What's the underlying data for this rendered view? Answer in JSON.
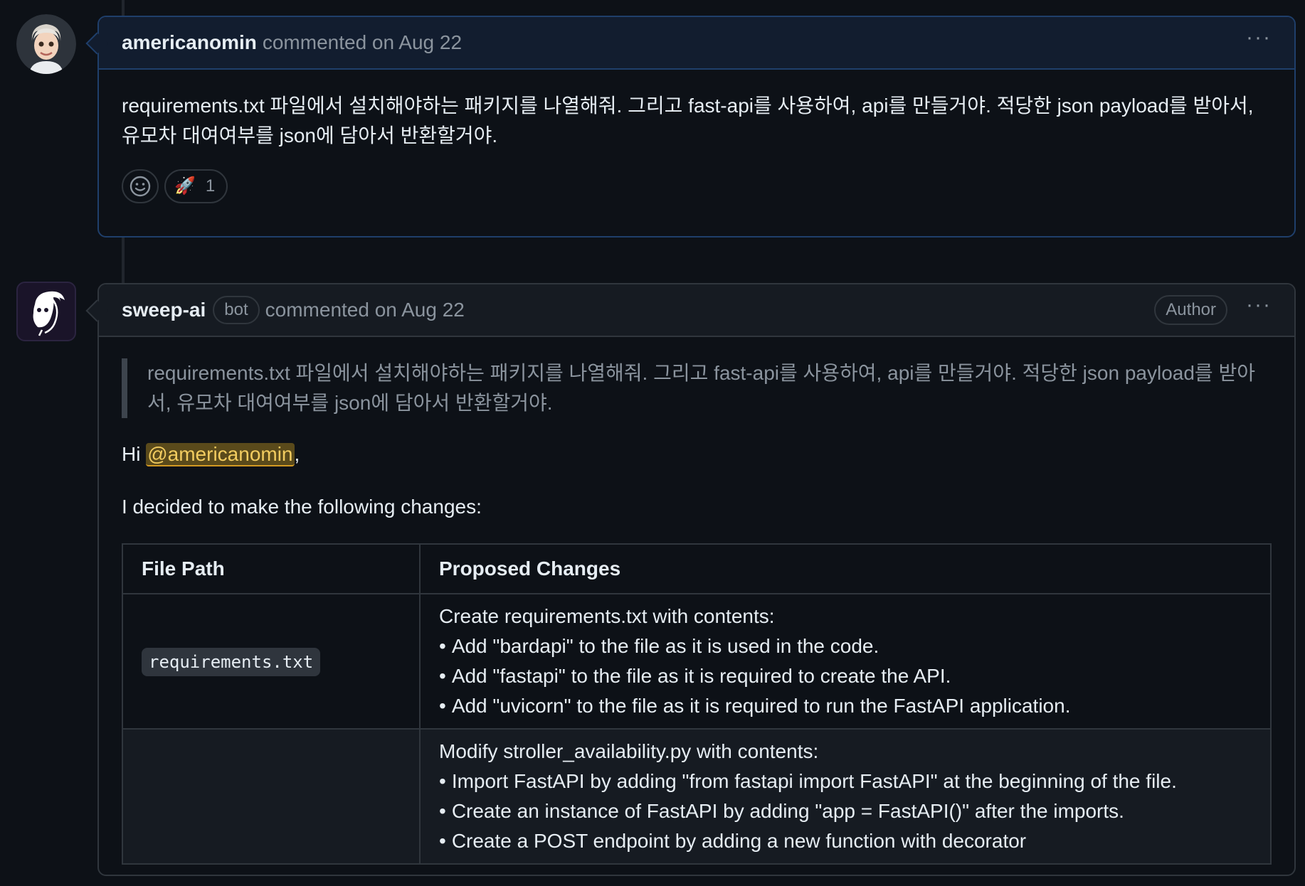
{
  "comments": [
    {
      "author": "americanomin",
      "meta": "commented on Aug 22",
      "body": "requirements.txt 파일에서 설치해야하는 패키지를 나열해줘. 그리고 fast-api를 사용하여, api를 만들거야. 적당한 json payload를 받아서, 유모차 대여여부를 json에 담아서 반환할거야.",
      "reactions": [
        {
          "icon": "rocket-icon",
          "emoji": "🚀",
          "count": "1"
        }
      ]
    },
    {
      "author": "sweep-ai",
      "bot_label": "bot",
      "meta": "commented on Aug 22",
      "author_badge": "Author",
      "quote": "requirements.txt 파일에서 설치해야하는 패키지를 나열해줘. 그리고 fast-api를 사용하여, api를 만들거야. 적당한 json payload를 받아서, 유모차 대여여부를 json에 담아서 반환할거야.",
      "greeting_prefix": "Hi ",
      "mention": "@americanomin",
      "greeting_suffix": ",",
      "intro": "I decided to make the following changes:",
      "table": {
        "headers": [
          "File Path",
          "Proposed Changes"
        ],
        "rows": [
          {
            "path": "requirements.txt",
            "title": "Create requirements.txt with contents:",
            "bullets": [
              "Add \"bardapi\" to the file as it is used in the code.",
              "Add \"fastapi\" to the file as it is required to create the API.",
              "Add \"uvicorn\" to the file as it is required to run the FastAPI application."
            ]
          },
          {
            "path": "",
            "title": "Modify stroller_availability.py with contents:",
            "bullets": [
              "Import FastAPI by adding \"from fastapi import FastAPI\" at the beginning of the file.",
              "Create an instance of FastAPI by adding \"app = FastAPI()\" after the imports.",
              "Create a POST endpoint by adding a new function with decorator"
            ]
          }
        ]
      }
    }
  ]
}
